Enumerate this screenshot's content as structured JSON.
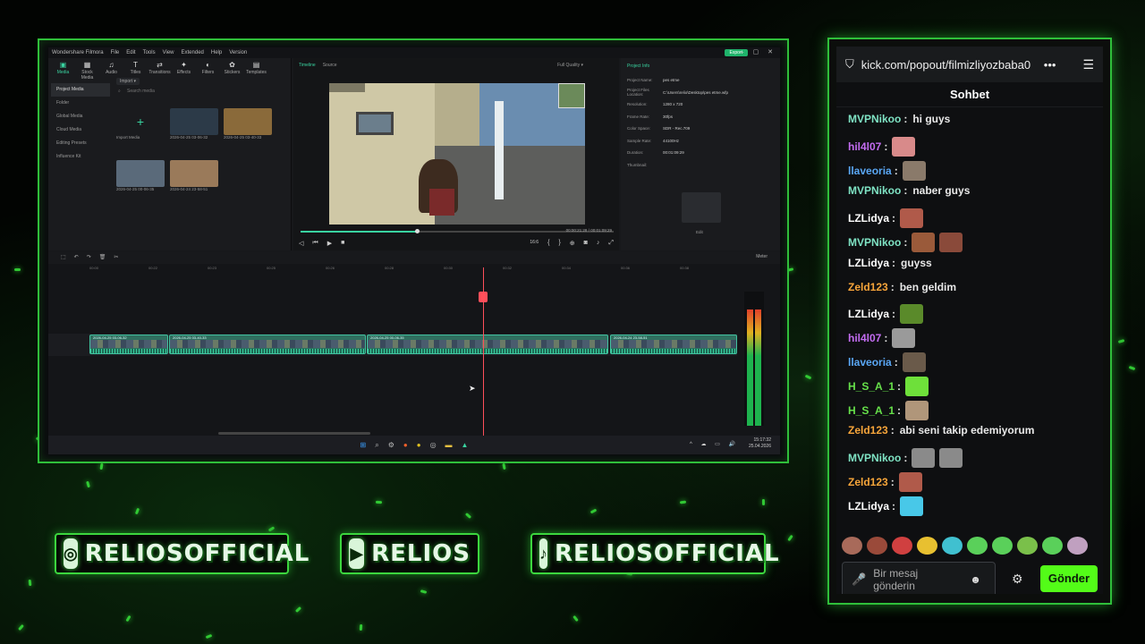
{
  "editor": {
    "app_title": "Wondershare Filmora",
    "menu": [
      "File",
      "Edit",
      "Tools",
      "View",
      "Extended",
      "Help",
      "Version"
    ],
    "export_label": "Export",
    "tools": [
      "Media",
      "Stock Media",
      "Audio",
      "Titles",
      "Transitions",
      "Effects",
      "Filters",
      "Stickers",
      "Templates"
    ],
    "nav": [
      "Project Media",
      "Folder",
      "Global Media",
      "Cloud Media",
      "Editing Presets",
      "Influence Kit"
    ],
    "import_label": "Import",
    "search_placeholder": "Search media",
    "media": [
      {
        "label": "Import Media"
      },
      {
        "label": "2026-04-25 03-06-32"
      },
      {
        "label": "2026-04-25 03-40-33"
      },
      {
        "label": "2026-04-25 00-06-35"
      },
      {
        "label": "2026-04-24 23-58-51"
      }
    ],
    "preview_tabs": [
      "Timeline",
      "Source"
    ],
    "quality": "Full Quality",
    "time_current": "00:00:21:28",
    "time_sep": "/",
    "time_total": "00:01:09:29",
    "progress": 0.37,
    "speed_label": "16:6",
    "project_info": {
      "title": "Project Info",
      "rows": [
        {
          "k": "Project Name:",
          "v": "pes etme"
        },
        {
          "k": "Project Files Location:",
          "v": "C:\\Users\\relio\\Desktop\\pes etme.wfp"
        },
        {
          "k": "Resolution:",
          "v": "1280 x 720"
        },
        {
          "k": "Frame Rate:",
          "v": "30fps"
        },
        {
          "k": "Color Space:",
          "v": "SDR - Rec.709"
        },
        {
          "k": "Sample Rate:",
          "v": "44100Hz"
        },
        {
          "k": "Duration:",
          "v": "00:01:09:29"
        },
        {
          "k": "Thumbnail:",
          "v": ""
        }
      ],
      "edit_label": "Edit"
    },
    "ruler": [
      "00:00",
      "00:22",
      "00:23",
      "00:25",
      "00:26",
      "00:28",
      "00:30",
      "00:32",
      "00:34",
      "00:36",
      "00:38"
    ],
    "clips": [
      {
        "label": "2026-04-25 03-06-32"
      },
      {
        "label": "2026-04-25 03-40-33"
      },
      {
        "label": "2026-04-25 00-06-35"
      },
      {
        "label": "2026-04-24 23-58-51"
      }
    ],
    "meter_label": "Meter",
    "clock_time": "15:17:32",
    "clock_date": "25.04.2026"
  },
  "chat": {
    "url": "kick.com/popout/filmizliyozbaba0",
    "title": "Sohbet",
    "messages": [
      {
        "user": "MVPNikoo",
        "color": "#7fe3c4",
        "text": "hi guys",
        "emotes": []
      },
      {
        "user": "hil4l07",
        "color": "#c26cf0",
        "text": "",
        "emotes": [
          "#d88a8a"
        ]
      },
      {
        "user": "llaveoria",
        "color": "#5aa7f5",
        "text": "",
        "emotes": [
          "#8a7a6a"
        ]
      },
      {
        "user": "MVPNikoo",
        "color": "#7fe3c4",
        "text": "naber guys",
        "emotes": []
      },
      {
        "user": "LZLidya",
        "color": "#ffffff",
        "text": "",
        "emotes": [
          "#b05a4a"
        ]
      },
      {
        "user": "MVPNikoo",
        "color": "#7fe3c4",
        "text": "",
        "emotes": [
          "#9a5a3a",
          "#8a4a3a"
        ]
      },
      {
        "user": "LZLidya",
        "color": "#ffffff",
        "text": "guyss",
        "emotes": []
      },
      {
        "user": "Zeld123",
        "color": "#f7a53a",
        "text": "ben geldim",
        "emotes": []
      },
      {
        "user": "LZLidya",
        "color": "#ffffff",
        "text": "",
        "emotes": [
          "#5a8a2a"
        ]
      },
      {
        "user": "hil4l07",
        "color": "#c26cf0",
        "text": "",
        "emotes": [
          "#9a9a9a"
        ]
      },
      {
        "user": "llaveoria",
        "color": "#5aa7f5",
        "text": "",
        "emotes": [
          "#6a5a4a"
        ]
      },
      {
        "user": "H_S_A_1",
        "color": "#66e04a",
        "text": "",
        "emotes": [
          "#6ee03a"
        ]
      },
      {
        "user": "H_S_A_1",
        "color": "#66e04a",
        "text": "",
        "emotes": [
          "#b0967a"
        ]
      },
      {
        "user": "Zeld123",
        "color": "#f7a53a",
        "text": "abi seni takip edemiyorum",
        "emotes": []
      },
      {
        "user": "MVPNikoo",
        "color": "#7fe3c4",
        "text": "",
        "emotes": [
          "#8a8a8a",
          "#8a8a8a"
        ]
      },
      {
        "user": "Zeld123",
        "color": "#f7a53a",
        "text": "",
        "emotes": [
          "#b05a4a"
        ]
      },
      {
        "user": "LZLidya",
        "color": "#ffffff",
        "text": "",
        "emotes": [
          "#48c8e8"
        ]
      }
    ],
    "emote_bar": [
      "#a86a5a",
      "#9a4a3a",
      "#d04040",
      "#e8c030",
      "#40c0d0",
      "#5ad05a",
      "#5ad05a",
      "#7ac04a",
      "#5ad05a",
      "#c0a0c0"
    ],
    "input_placeholder": "Bir mesaj gönderin",
    "send_label": "Gönder"
  },
  "socials": [
    {
      "icon": "instagram-icon",
      "label": "RELIOSOFFICIAL"
    },
    {
      "icon": "youtube-icon",
      "label": "RELIOS"
    },
    {
      "icon": "tiktok-icon",
      "label": "RELIOSOFFICIAL"
    }
  ],
  "colors": {
    "accent": "#2fbf3a",
    "kick_green": "#53fc18",
    "filmora_teal": "#39d3a0"
  }
}
